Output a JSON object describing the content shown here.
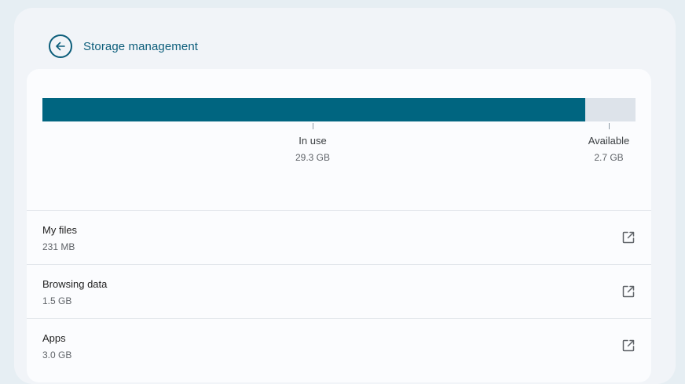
{
  "header": {
    "back_icon": "arrow-left-icon",
    "title": "Storage management"
  },
  "usage": {
    "in_use_fraction": 0.9156,
    "in_use_label": "In use",
    "in_use_value": "29.3 GB",
    "available_label": "Available",
    "available_value": "2.7 GB",
    "colors": {
      "in_use": "#006580",
      "available": "#dde3ea"
    }
  },
  "items": [
    {
      "label": "My files",
      "value": "231 MB",
      "icon": "open-in-new-icon"
    },
    {
      "label": "Browsing data",
      "value": "1.5 GB",
      "icon": "open-in-new-icon"
    },
    {
      "label": "Apps",
      "value": "3.0 GB",
      "icon": "open-in-new-icon"
    }
  ]
}
